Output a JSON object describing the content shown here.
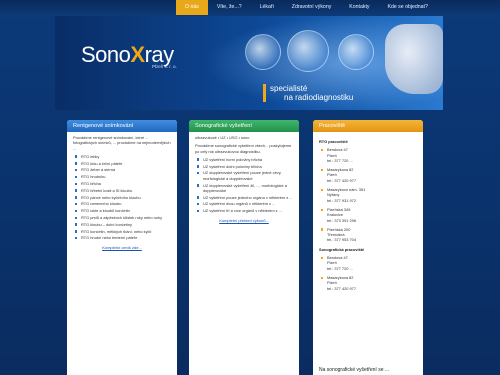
{
  "nav": [
    "O nás",
    "Víte, že...?",
    "Lékaři",
    "Zdravotní výkony",
    "Kontakty",
    "Kde se objednat?"
  ],
  "brand": {
    "name_a": "Sono",
    "name_x": "X",
    "name_b": "ray",
    "sub": "Plzeň s. r. o."
  },
  "tagline": {
    "line1": "specialisté",
    "line2": "na radiodiagnostiku"
  },
  "col1": {
    "title": "Rentgenové snímkování",
    "intro": "Provádíme rentgenové snímkování, které ... fotografických snímků, ... provádíme na nejmodernějších ...",
    "items": [
      "RTG lebky",
      "RTG krku a krční páteře",
      "RTG žeber a sterna",
      "RTG hrudníku",
      "RTG břicha",
      "RTG hřbetní kosti a SI kloubu",
      "RTG pánve nebo kyčelního kloubu",
      "RTG ramenního kloubu",
      "RTG lokte a kloubů končetin",
      "RTG prstů a zápěstních kůstek ruky nebo nohy",
      "RTG kloubu – dolní končetiny",
      "RTG končetin, měkkých tkání, nebo kyčlí",
      "RTG hrudní nebo bederní páteře"
    ],
    "more": "Kompletní ceník zde..."
  },
  "col2": {
    "title": "Sonografické vyšetření",
    "subtitle": "ultrazvukové • UZ • USG • sono",
    "intro": "Provádíme sonografické vyšetření všech... poskytujeme po celý rok ultrazvukovou diagnostiku.",
    "items": [
      "UZ vyšetření horní poloviny břicha",
      "UZ vyšetření dolní poloviny břicha",
      "UZ dopplerovské vyšetření pouze jedné cévy, morfologické a dopplerovské",
      "UZ dopplerovské vyšetření žil, ..., morfologické a dopplerovské",
      "UZ vyšetření pouze jednoho orgánu v některém z ...",
      "UZ vyšetření dvou orgánů v některém z ...",
      "UZ vyšetření tří a více orgánů v některém z ..."
    ],
    "more": "Kompletní přehled výkonů..."
  },
  "col3": {
    "title": "Pracoviště",
    "section1": "RTG pracoviště",
    "addr1": [
      {
        "street": "Bendova 47",
        "city": "Plzeň",
        "phone": "tel.: 377 720 ..."
      },
      {
        "street": "Masarykova 82",
        "city": "Plzeň",
        "phone": "tel.: 377 420 977"
      },
      {
        "street": "Masarykovo nám. 351",
        "city": "Nýřany",
        "phone": "tel.: 377 931 972"
      },
      {
        "street": "Plzeňská 345",
        "city": "Kralovice",
        "phone": "tel.: 373 391 296"
      },
      {
        "street": "Plzeňská 200",
        "city": "Třemošná",
        "phone": "tel.: 377 953 704"
      }
    ],
    "section2": "Sonografická pracoviště",
    "addr2": [
      {
        "street": "Bendova 47",
        "city": "Plzeň",
        "phone": "tel.: 377 720 ..."
      },
      {
        "street": "Masarykova 82",
        "city": "Plzeň",
        "phone": "tel.: 377 420 977"
      }
    ],
    "footnote": "Na sonografické vyšetření se ..."
  }
}
